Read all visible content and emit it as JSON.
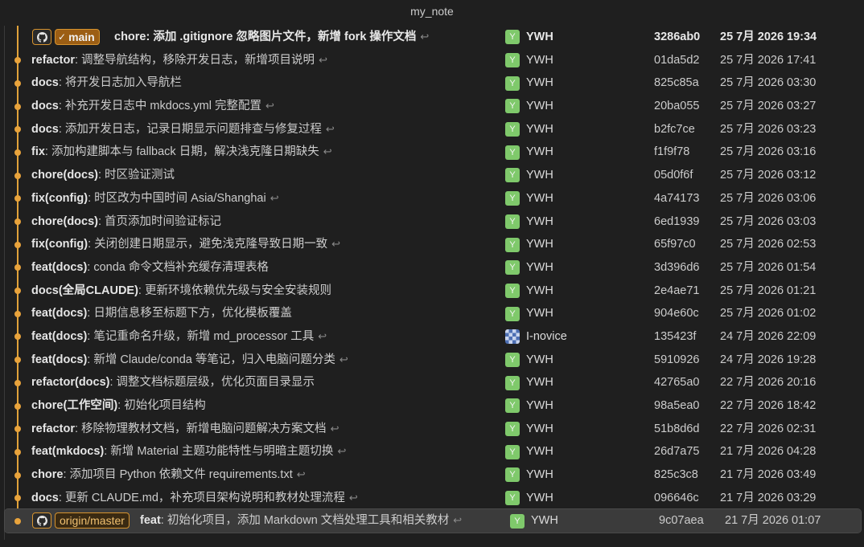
{
  "window": {
    "title": "my_note"
  },
  "commits": [
    {
      "type": "chore",
      "msg": ": 添加 .gitignore 忽略图片文件，新增 fork 操作文档",
      "author": "YWH",
      "avatar": "Y",
      "hash": "3286ab0",
      "date": "25 7月 2026 19:34",
      "refs": [
        "main"
      ],
      "head": true
    },
    {
      "type": "refactor",
      "msg": ": 调整导航结构，移除开发日志，新增项目说明",
      "author": "YWH",
      "avatar": "Y",
      "hash": "01da5d2",
      "date": "25 7月 2026 17:41"
    },
    {
      "type": "docs",
      "msg": ": 将开发日志加入导航栏",
      "author": "YWH",
      "avatar": "Y",
      "hash": "825c85a",
      "date": "25 7月 2026 03:30"
    },
    {
      "type": "docs",
      "msg": ": 补充开发日志中 mkdocs.yml 完整配置",
      "author": "YWH",
      "avatar": "Y",
      "hash": "20ba055",
      "date": "25 7月 2026 03:27"
    },
    {
      "type": "docs",
      "msg": ": 添加开发日志，记录日期显示问题排查与修复过程",
      "author": "YWH",
      "avatar": "Y",
      "hash": "b2fc7ce",
      "date": "25 7月 2026 03:23"
    },
    {
      "type": "fix",
      "msg": ": 添加构建脚本与 fallback 日期，解决浅克隆日期缺失",
      "author": "YWH",
      "avatar": "Y",
      "hash": "f1f9f78",
      "date": "25 7月 2026 03:16"
    },
    {
      "type": "chore(docs)",
      "msg": ": 时区验证测试",
      "author": "YWH",
      "avatar": "Y",
      "hash": "05d0f6f",
      "date": "25 7月 2026 03:12"
    },
    {
      "type": "fix(config)",
      "msg": ": 时区改为中国时间 Asia/Shanghai",
      "author": "YWH",
      "avatar": "Y",
      "hash": "4a74173",
      "date": "25 7月 2026 03:06"
    },
    {
      "type": "chore(docs)",
      "msg": ": 首页添加时间验证标记",
      "author": "YWH",
      "avatar": "Y",
      "hash": "6ed1939",
      "date": "25 7月 2026 03:03"
    },
    {
      "type": "fix(config)",
      "msg": ": 关闭创建日期显示，避免浅克隆导致日期一致",
      "author": "YWH",
      "avatar": "Y",
      "hash": "65f97c0",
      "date": "25 7月 2026 02:53"
    },
    {
      "type": "feat(docs)",
      "msg": ": conda 命令文档补充缓存清理表格",
      "author": "YWH",
      "avatar": "Y",
      "hash": "3d396d6",
      "date": "25 7月 2026 01:54"
    },
    {
      "type": "docs(全局CLAUDE)",
      "msg": ": 更新环境依赖优先级与安全安装规则",
      "author": "YWH",
      "avatar": "Y",
      "hash": "2e4ae71",
      "date": "25 7月 2026 01:21"
    },
    {
      "type": "feat(docs)",
      "msg": ": 日期信息移至标题下方，优化模板覆盖",
      "author": "YWH",
      "avatar": "Y",
      "hash": "904e60c",
      "date": "25 7月 2026 01:02"
    },
    {
      "type": "feat(docs)",
      "msg": ": 笔记重命名升级，新增 md_processor 工具",
      "author": "I-novice",
      "avatar": "",
      "hash": "135423f",
      "date": "24 7月 2026 22:09",
      "alt_avatar": true
    },
    {
      "type": "feat(docs)",
      "msg": ": 新增 Claude/conda 等笔记，归入电脑问题分类",
      "author": "YWH",
      "avatar": "Y",
      "hash": "5910926",
      "date": "24 7月 2026 19:28"
    },
    {
      "type": "refactor(docs)",
      "msg": ": 调整文档标题层级，优化页面目录显示",
      "author": "YWH",
      "avatar": "Y",
      "hash": "42765a0",
      "date": "22 7月 2026 20:16"
    },
    {
      "type": "chore(工作空间)",
      "msg": ": 初始化项目结构",
      "author": "YWH",
      "avatar": "Y",
      "hash": "98a5ea0",
      "date": "22 7月 2026 18:42"
    },
    {
      "type": "refactor",
      "msg": ": 移除物理教材文档，新增电脑问题解决方案文档",
      "author": "YWH",
      "avatar": "Y",
      "hash": "51b8d6d",
      "date": "22 7月 2026 02:31"
    },
    {
      "type": "feat(mkdocs)",
      "msg": ": 新增 Material 主题功能特性与明暗主题切换",
      "author": "YWH",
      "avatar": "Y",
      "hash": "26d7a75",
      "date": "21 7月 2026 04:28"
    },
    {
      "type": "chore",
      "msg": ": 添加项目 Python 依赖文件 requirements.txt",
      "author": "YWH",
      "avatar": "Y",
      "hash": "825c3c8",
      "date": "21 7月 2026 03:49"
    },
    {
      "type": "docs",
      "msg": ": 更新 CLAUDE.md，补充项目架构说明和教材处理流程",
      "author": "YWH",
      "avatar": "Y",
      "hash": "096646c",
      "date": "21 7月 2026 03:29"
    },
    {
      "type": "feat",
      "msg": ": 初始化项目，添加 Markdown 文档处理工具和相关教材",
      "author": "YWH",
      "avatar": "Y",
      "hash": "9c07aea",
      "date": "21 7月 2026 01:07",
      "refs": [
        "origin/master"
      ],
      "selected": true
    }
  ],
  "icons": {
    "github": "github-icon",
    "check": "✓",
    "return": "↩"
  }
}
